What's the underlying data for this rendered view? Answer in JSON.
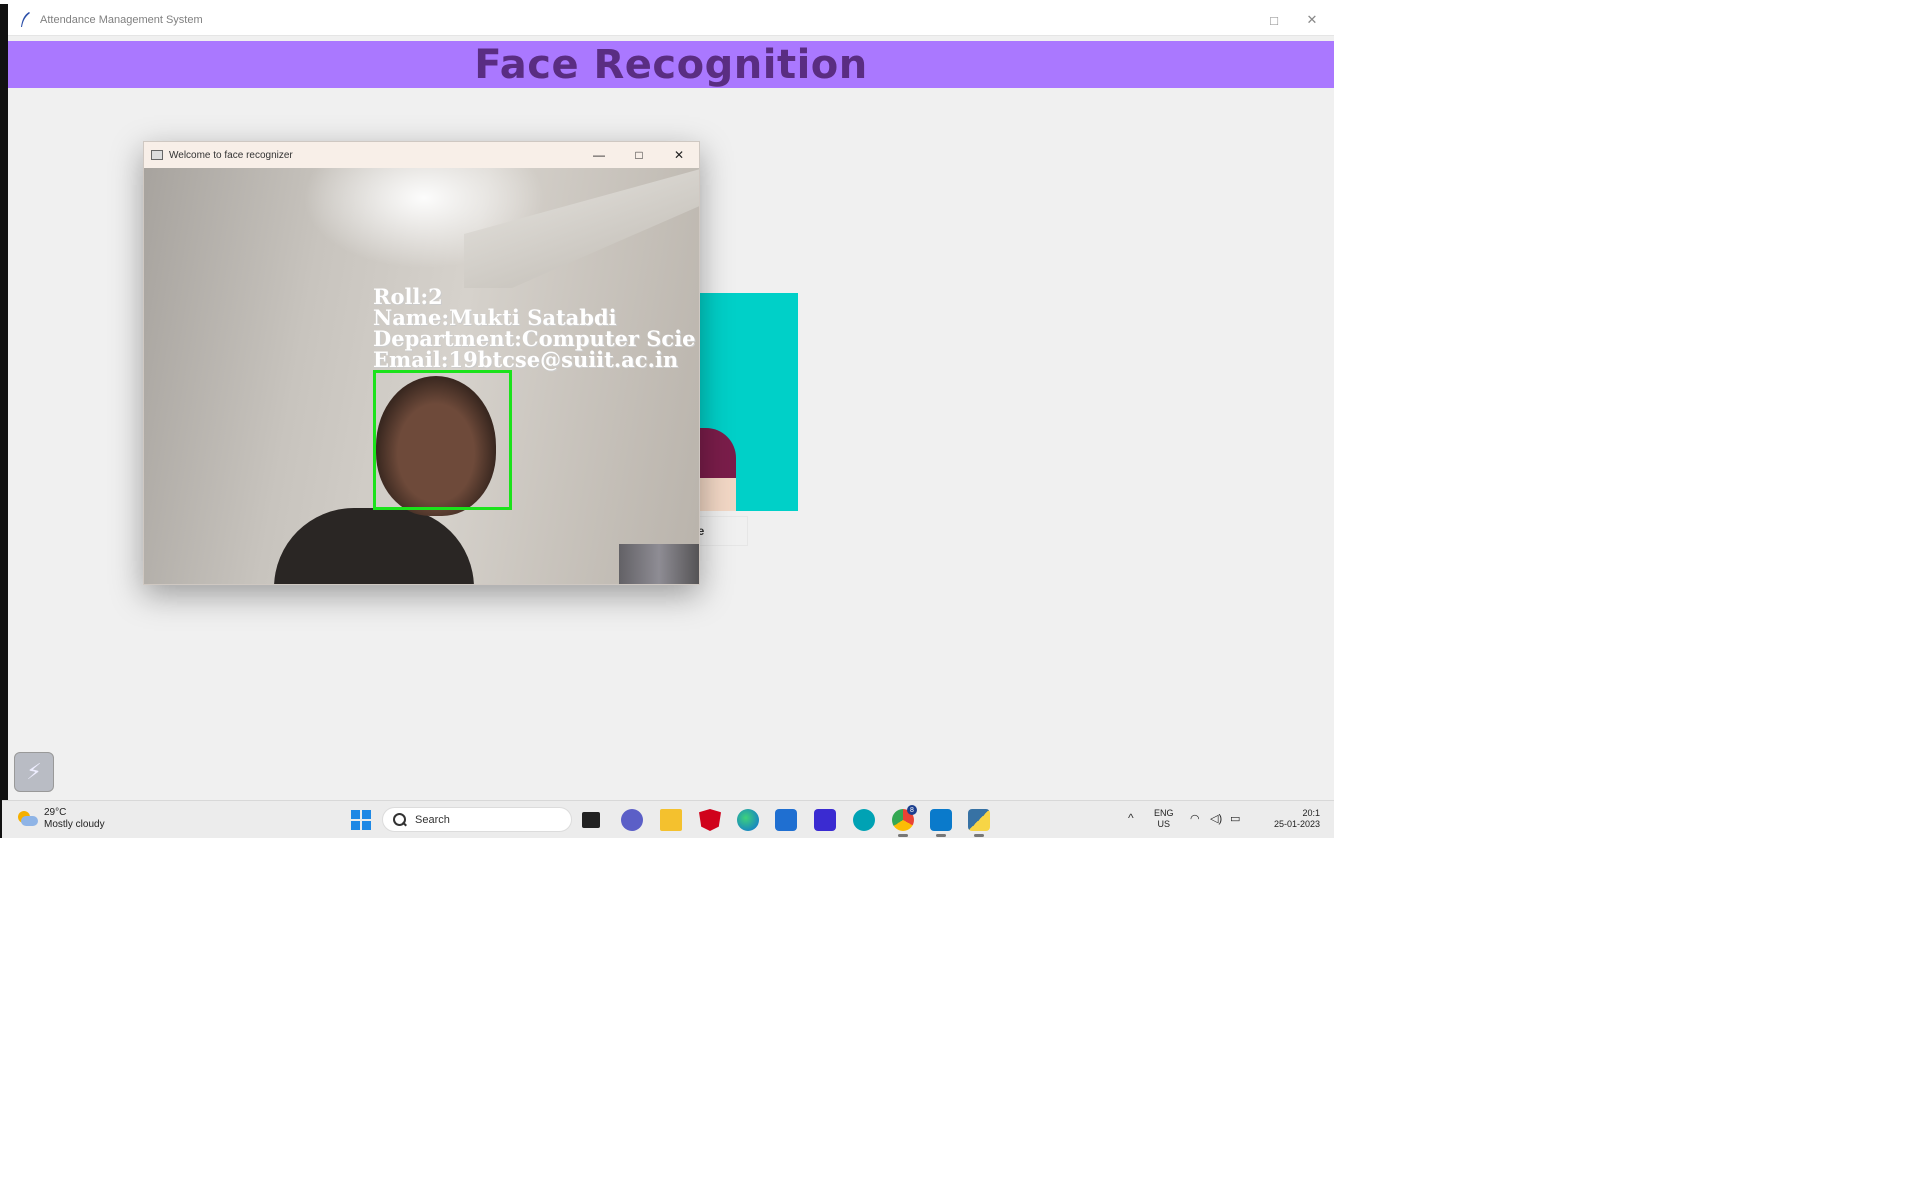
{
  "app": {
    "window_title": "Attendance Management System",
    "banner_title": "Face Recognition",
    "banner_color": "#aa78ff",
    "maximize_icon": "□",
    "close_icon": "✕",
    "partial_button_label": "ce"
  },
  "face_window": {
    "title": "Welcome to face recognizer",
    "minimize_icon": "—",
    "maximize_icon": "□",
    "close_icon": "✕",
    "overlay": {
      "roll": "Roll:2",
      "name": "Name:Mukti Satabdi",
      "department": "Department:Computer Scie",
      "email": "Email:19btcse@suiit.ac.in"
    },
    "face_box_color": "#1be21b"
  },
  "taskbar": {
    "weather": {
      "temperature": "29°C",
      "condition": "Mostly cloudy"
    },
    "search_placeholder": "Search",
    "chrome_badge": "8",
    "tray": {
      "chevron": "^",
      "lang_line1": "ENG",
      "lang_line2": "US",
      "time": "20:1",
      "date": "25-01-2023"
    },
    "apps": [
      "task-view",
      "chat",
      "file-explorer",
      "mcafee",
      "edge",
      "microsoft-store",
      "mathpix",
      "cortana",
      "chrome",
      "vscode",
      "python"
    ]
  },
  "widget": {
    "icon": "lightning-icon"
  }
}
